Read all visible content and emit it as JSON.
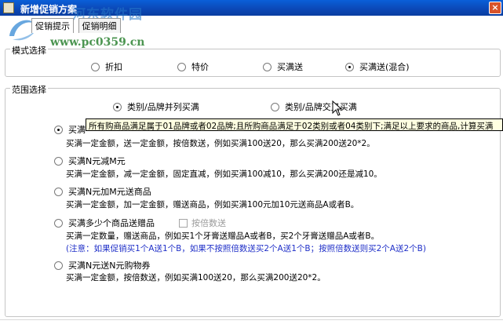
{
  "window": {
    "title": "新增促销方案",
    "close_glyph": "×"
  },
  "watermark": {
    "name": "河东软件园",
    "url": "www.pc0359.cn"
  },
  "tabs": [
    {
      "label": "促销提示"
    },
    {
      "label": "促销明细"
    }
  ],
  "type_group": {
    "legend": "模式选择",
    "options": [
      {
        "label": "折扣",
        "selected": false
      },
      {
        "label": "特价",
        "selected": false
      },
      {
        "label": "买满送",
        "selected": false
      },
      {
        "label": "买满送(混合)",
        "selected": true
      }
    ]
  },
  "scope_group": {
    "legend": "范围选择",
    "scope_options": [
      {
        "label": "类别/品牌并列买满",
        "selected": true
      },
      {
        "label": "类别/品牌交叉买满",
        "selected": false
      }
    ],
    "tooltip": "所有购商品满足属于01品牌或者02品牌;且所购商品满足于02类别或者04类别下;满足以上要求的商品,计算买满",
    "items": [
      {
        "label": "买满",
        "selected": true,
        "desc": "买满一定金额，送一定金额，按倍数送，例如买满100送20，那么买满200送20*2。"
      },
      {
        "label": "买满N元减M元",
        "selected": false,
        "desc": "买满一定金额，减一定金额，固定直减，例如买满100减10，那么买满200还是减10。"
      },
      {
        "label": "买满N元加M元送商品",
        "selected": false,
        "desc": "买满一定金额，加一定金额，赠送商品，例如买满100元加10元送商品A或者B。"
      },
      {
        "label": "买满多少个商品送赠品",
        "selected": false,
        "desc": "买满一定数量，赠送商品，例如买1个牙膏送赠品A或者B，买2个牙膏送赠品A或者B。",
        "checkbox_label": "按倍数送",
        "note": "(注意：如果促销买1个A送1个B，如果不按照倍数送买2个A送1个B；按照倍数送则买2个A送2个B)"
      },
      {
        "label": "买满N元送N元购物券",
        "selected": false,
        "desc": "买满一定金额，按倍数送，例如买满100送20，那么买满200送20*2。"
      }
    ]
  },
  "colors": {
    "titlebar": "#0b49b8",
    "note": "#2030c8",
    "tooltip_bg": "#ffffe1"
  }
}
